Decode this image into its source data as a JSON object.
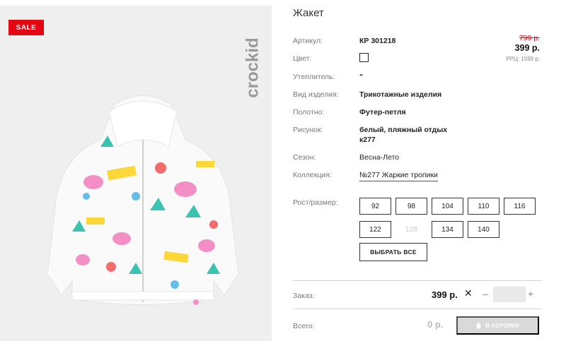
{
  "product": {
    "title": "Жакет",
    "badge": "SALE",
    "brand": "crockid"
  },
  "specs": {
    "article": {
      "label": "Артикул:",
      "value": "КР 301218"
    },
    "color": {
      "label": "Цвет:"
    },
    "insulation": {
      "label": "Утеплитель:",
      "value": "\""
    },
    "type": {
      "label": "Вид изделия:",
      "value": "Трикотажные изделия"
    },
    "fabric": {
      "label": "Полотно:",
      "value": "Футер-петля"
    },
    "pattern": {
      "label": "Рисунок:",
      "value_line1": "белый, пляжный отдых",
      "value_line2": "к277"
    },
    "season": {
      "label": "Сезон:",
      "value": "Весна-Лето"
    },
    "collection": {
      "label": "Коллекция:",
      "value": "№277 Жаркие тропики"
    }
  },
  "price": {
    "old": "799 р.",
    "current": "399 р.",
    "rrp": "РРЦ: 1599 р."
  },
  "sizes": {
    "label": "Рост/размер:",
    "options": [
      {
        "value": "92",
        "available": true
      },
      {
        "value": "98",
        "available": true
      },
      {
        "value": "104",
        "available": true
      },
      {
        "value": "110",
        "available": true
      },
      {
        "value": "116",
        "available": true
      },
      {
        "value": "122",
        "available": true
      },
      {
        "value": "128",
        "available": false
      },
      {
        "value": "134",
        "available": true
      },
      {
        "value": "140",
        "available": true
      }
    ],
    "select_all": "ВЫБРАТЬ ВСЕ"
  },
  "order": {
    "label": "Заказ:",
    "price": "399 р.",
    "remove_glyph": "✕",
    "minus": "–",
    "plus": "+",
    "quantity": ""
  },
  "total": {
    "label": "Всего:",
    "value": "0 р.",
    "cart_button": "В КОРЗИНУ"
  },
  "colors": {
    "sale": "#e30613",
    "old_price": "#e30613",
    "image_bg": "#efefef",
    "cart_disabled": "#d9d9d9"
  }
}
